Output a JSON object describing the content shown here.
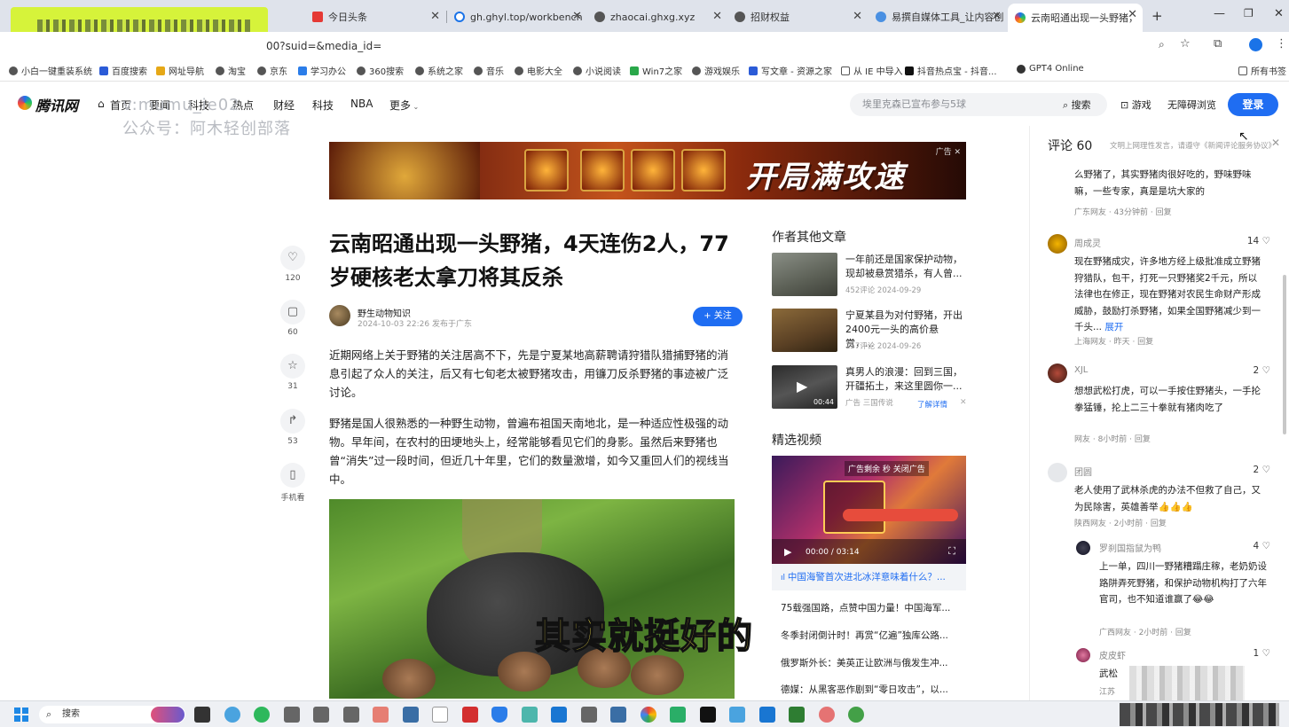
{
  "browser": {
    "tabs": [
      {
        "title": "今日头条"
      },
      {
        "title": "gh.ghyl.top/workbench"
      },
      {
        "title": "zhaocai.ghxg.xyz"
      },
      {
        "title": "招财权益"
      },
      {
        "title": "易撰自媒体工具_让内容创"
      },
      {
        "title": "云南昭通出现一头野猪，"
      }
    ],
    "new_tab": "+",
    "url": "00?suid=&media_id=",
    "bookmarks": [
      "小白一键重装系统",
      "百度搜索",
      "网址导航",
      "淘宝",
      "京东",
      "学习办公",
      "360搜索",
      "系统之家",
      "音乐",
      "电影大全",
      "小说阅读",
      "Win7之家",
      "游戏娱乐",
      "写文章 - 资源之家",
      "从 IE 中导入",
      "抖音热点宝 - 抖音...",
      "GPT4 Online",
      "所有书签"
    ]
  },
  "site": {
    "logo": "腾讯网",
    "nav": [
      "首页",
      "要闻",
      "科技",
      "热点",
      "财经",
      "科技",
      "NBA",
      "更多"
    ],
    "search_placeholder": "埃里克森已宣布参与5球",
    "search_label": "搜索",
    "games": "游戏",
    "accessible": "无障碍浏览",
    "login": "登录",
    "watermark1": "v:mumu_ie02",
    "watermark2": "公众号：阿木轻创部落"
  },
  "ad": {
    "slogan": "开局满攻速",
    "tag": "广告"
  },
  "article": {
    "title": "云南昭通出现一头野猪，4天连伤2人，77岁硬核老太拿刀将其反杀",
    "author": "野生动物知识",
    "meta": "2024-10-03 22:26 发布于广东",
    "follow": "+ 关注",
    "paragraphs": [
      "近期网络上关于野猪的关注居高不下，先是宁夏某地高薪聘请狩猎队猎捕野猪的消息引起了众人的关注，后又有七旬老太被野猪攻击，用镰刀反杀野猪的事迹被广泛讨论。",
      "野猪是国人很熟悉的一种野生动物，曾遍布祖国天南地北，是一种适应性极强的动物。早年间，在农村的田埂地头上，经常能够看见它们的身影。虽然后来野猪也曾“消失”过一段时间，但近几十年里，它们的数量激增，如今又重回人们的视线当中。"
    ],
    "video_subtitle": "其实就挺好的"
  },
  "actions": [
    {
      "icon": "heart-icon",
      "glyph": "♡",
      "count": "120"
    },
    {
      "icon": "comment-icon",
      "glyph": "▢",
      "count": "60"
    },
    {
      "icon": "star-icon",
      "glyph": "☆",
      "count": "31"
    },
    {
      "icon": "share-icon",
      "glyph": "↱",
      "count": "53"
    },
    {
      "icon": "phone-icon",
      "glyph": "▯",
      "count": "手机看"
    }
  ],
  "sidebar": {
    "other_title": "作者其他文章",
    "other": [
      {
        "title": "一年前还是国家保护动物，现却被悬赏猎杀，有人曾...",
        "meta": "452评论   2024-09-29"
      },
      {
        "title": "宁夏某县为对付野猪，开出2400元一头的高价悬赏，...",
        "meta": "157评论   2024-09-26"
      },
      {
        "title": "真男人的浪漫：回到三国，开疆拓土，来这里圆你一...",
        "meta": "广告   三国传说",
        "extra": "了解详情",
        "duration": "00:44"
      }
    ],
    "video_title": "精选视频",
    "video_ad": "广告剩余 秒  关闭广告",
    "video_time": "00:00 / 03:14",
    "video_caption": "中国海警首次进北冰洋意味着什么？...",
    "video_list": [
      "75载强国路，点赞中国力量！中国海军...",
      "冬季封闭倒计时！再赏“亿遍”独库公路...",
      "俄罗斯外长：美英正让欧洲与俄发生冲...",
      "德媒：从黑客恶作剧到“零日攻击”，以..."
    ]
  },
  "comments": {
    "title": "评论",
    "count": "60",
    "hint": "文明上网理性发言，请遵守《新闻评论服务协议》",
    "items": [
      {
        "name": "",
        "likes": "",
        "text": "么野猪了，其实野猪肉很好吃的，野味野味嘛，一些专家，真是是坑大家的",
        "footer": "广东网友 · 43分钟前 · 回复"
      },
      {
        "name": "周成灵",
        "likes": "14",
        "text": "现在野猪成灾，许多地方经上级批准成立野猪狩猎队，包干，打死一只野猪奖2千元，所以法律也在修正，现在野猪对农民生命财产形成威胁，鼓励打杀野猪，如果全国野猪减少到一千头...",
        "more": "展开",
        "footer": "上海网友 · 昨天 · 回复"
      },
      {
        "name": "XJL",
        "likes": "2",
        "text": "想想武松打虎，可以一手按住野猪头，一手抡拳猛锤，抡上二三十拳就有猪肉吃了",
        "footer": "网友 · 8小时前 · 回复"
      },
      {
        "name": "团圆",
        "likes": "2",
        "text": "老人使用了武林杀虎的办法不但救了自己，又为民除害，英雄善举👍👍👍",
        "footer": "陕西网友 · 2小时前 · 回复"
      },
      {
        "name": "罗刹国指鼠为鸭",
        "likes": "4",
        "text": "上一单，四川一野猪糟蹋庄稼，老奶奶设路阱弄死野猪，和保护动物机构打了六年官司，也不知道谁赢了😂😂",
        "footer": "广西网友 · 2小时前 · 回复"
      },
      {
        "name": "皮皮虾",
        "likes": "1",
        "text": "武松",
        "footer": "江苏"
      }
    ]
  },
  "taskbar": {
    "search": "搜索"
  }
}
